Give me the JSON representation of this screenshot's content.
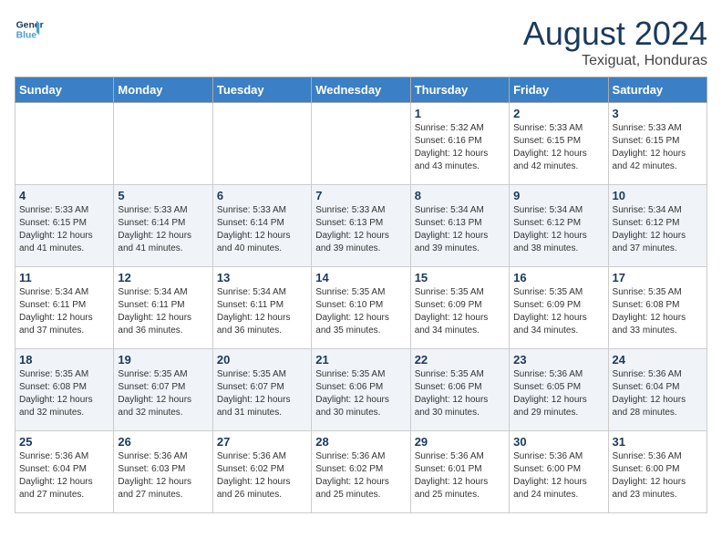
{
  "header": {
    "logo_general": "General",
    "logo_blue": "Blue",
    "title": "August 2024",
    "subtitle": "Texiguat, Honduras"
  },
  "weekdays": [
    "Sunday",
    "Monday",
    "Tuesday",
    "Wednesday",
    "Thursday",
    "Friday",
    "Saturday"
  ],
  "weeks": [
    [
      {
        "day": "",
        "info": ""
      },
      {
        "day": "",
        "info": ""
      },
      {
        "day": "",
        "info": ""
      },
      {
        "day": "",
        "info": ""
      },
      {
        "day": "1",
        "info": "Sunrise: 5:32 AM\nSunset: 6:16 PM\nDaylight: 12 hours\nand 43 minutes."
      },
      {
        "day": "2",
        "info": "Sunrise: 5:33 AM\nSunset: 6:15 PM\nDaylight: 12 hours\nand 42 minutes."
      },
      {
        "day": "3",
        "info": "Sunrise: 5:33 AM\nSunset: 6:15 PM\nDaylight: 12 hours\nand 42 minutes."
      }
    ],
    [
      {
        "day": "4",
        "info": "Sunrise: 5:33 AM\nSunset: 6:15 PM\nDaylight: 12 hours\nand 41 minutes."
      },
      {
        "day": "5",
        "info": "Sunrise: 5:33 AM\nSunset: 6:14 PM\nDaylight: 12 hours\nand 41 minutes."
      },
      {
        "day": "6",
        "info": "Sunrise: 5:33 AM\nSunset: 6:14 PM\nDaylight: 12 hours\nand 40 minutes."
      },
      {
        "day": "7",
        "info": "Sunrise: 5:33 AM\nSunset: 6:13 PM\nDaylight: 12 hours\nand 39 minutes."
      },
      {
        "day": "8",
        "info": "Sunrise: 5:34 AM\nSunset: 6:13 PM\nDaylight: 12 hours\nand 39 minutes."
      },
      {
        "day": "9",
        "info": "Sunrise: 5:34 AM\nSunset: 6:12 PM\nDaylight: 12 hours\nand 38 minutes."
      },
      {
        "day": "10",
        "info": "Sunrise: 5:34 AM\nSunset: 6:12 PM\nDaylight: 12 hours\nand 37 minutes."
      }
    ],
    [
      {
        "day": "11",
        "info": "Sunrise: 5:34 AM\nSunset: 6:11 PM\nDaylight: 12 hours\nand 37 minutes."
      },
      {
        "day": "12",
        "info": "Sunrise: 5:34 AM\nSunset: 6:11 PM\nDaylight: 12 hours\nand 36 minutes."
      },
      {
        "day": "13",
        "info": "Sunrise: 5:34 AM\nSunset: 6:11 PM\nDaylight: 12 hours\nand 36 minutes."
      },
      {
        "day": "14",
        "info": "Sunrise: 5:35 AM\nSunset: 6:10 PM\nDaylight: 12 hours\nand 35 minutes."
      },
      {
        "day": "15",
        "info": "Sunrise: 5:35 AM\nSunset: 6:09 PM\nDaylight: 12 hours\nand 34 minutes."
      },
      {
        "day": "16",
        "info": "Sunrise: 5:35 AM\nSunset: 6:09 PM\nDaylight: 12 hours\nand 34 minutes."
      },
      {
        "day": "17",
        "info": "Sunrise: 5:35 AM\nSunset: 6:08 PM\nDaylight: 12 hours\nand 33 minutes."
      }
    ],
    [
      {
        "day": "18",
        "info": "Sunrise: 5:35 AM\nSunset: 6:08 PM\nDaylight: 12 hours\nand 32 minutes."
      },
      {
        "day": "19",
        "info": "Sunrise: 5:35 AM\nSunset: 6:07 PM\nDaylight: 12 hours\nand 32 minutes."
      },
      {
        "day": "20",
        "info": "Sunrise: 5:35 AM\nSunset: 6:07 PM\nDaylight: 12 hours\nand 31 minutes."
      },
      {
        "day": "21",
        "info": "Sunrise: 5:35 AM\nSunset: 6:06 PM\nDaylight: 12 hours\nand 30 minutes."
      },
      {
        "day": "22",
        "info": "Sunrise: 5:35 AM\nSunset: 6:06 PM\nDaylight: 12 hours\nand 30 minutes."
      },
      {
        "day": "23",
        "info": "Sunrise: 5:36 AM\nSunset: 6:05 PM\nDaylight: 12 hours\nand 29 minutes."
      },
      {
        "day": "24",
        "info": "Sunrise: 5:36 AM\nSunset: 6:04 PM\nDaylight: 12 hours\nand 28 minutes."
      }
    ],
    [
      {
        "day": "25",
        "info": "Sunrise: 5:36 AM\nSunset: 6:04 PM\nDaylight: 12 hours\nand 27 minutes."
      },
      {
        "day": "26",
        "info": "Sunrise: 5:36 AM\nSunset: 6:03 PM\nDaylight: 12 hours\nand 27 minutes."
      },
      {
        "day": "27",
        "info": "Sunrise: 5:36 AM\nSunset: 6:02 PM\nDaylight: 12 hours\nand 26 minutes."
      },
      {
        "day": "28",
        "info": "Sunrise: 5:36 AM\nSunset: 6:02 PM\nDaylight: 12 hours\nand 25 minutes."
      },
      {
        "day": "29",
        "info": "Sunrise: 5:36 AM\nSunset: 6:01 PM\nDaylight: 12 hours\nand 25 minutes."
      },
      {
        "day": "30",
        "info": "Sunrise: 5:36 AM\nSunset: 6:00 PM\nDaylight: 12 hours\nand 24 minutes."
      },
      {
        "day": "31",
        "info": "Sunrise: 5:36 AM\nSunset: 6:00 PM\nDaylight: 12 hours\nand 23 minutes."
      }
    ]
  ]
}
